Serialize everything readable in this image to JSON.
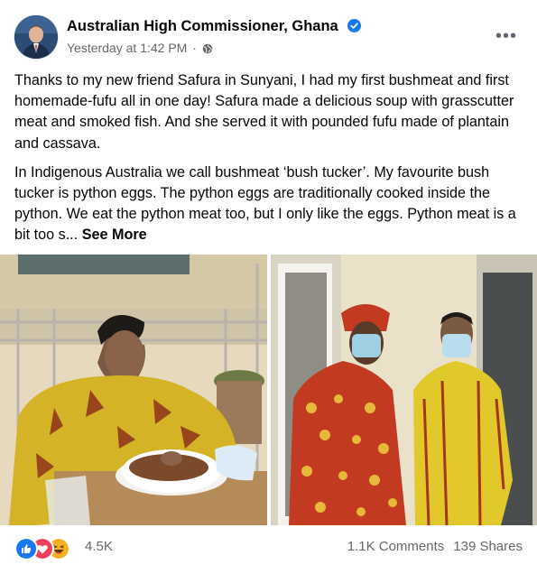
{
  "post": {
    "author": "Australian High Commissioner, Ghana",
    "timestamp": "Yesterday at 1:42 PM",
    "separator": "·",
    "more_icon_label": "•••",
    "paragraph_1": "Thanks to my new friend Safura in Sunyani, I had my first bushmeat and first homemade-fufu all in one day! Safura made a delicious soup with grasscutter meat and smoked fish. And she served it with pounded fufu made of plantain and cassava.",
    "paragraph_2": "In Indigenous Australia we call bushmeat ‘bush tucker’. My favourite bush tucker is python eggs. The python eggs are traditionally cooked inside the python. We eat the python meat too, but I only like the eggs. Python meat is a bit too s...",
    "see_more": "See More"
  },
  "footer": {
    "reaction_count": "4.5K",
    "comments": "1.1K Comments",
    "shares": "139 Shares"
  },
  "icons": {
    "verified": "verified-badge-icon",
    "privacy": "globe-icon",
    "more": "more-options-icon",
    "reactions": [
      "like-icon",
      "love-icon",
      "haha-icon"
    ]
  },
  "colors": {
    "link_blue": "#1877f2",
    "secondary_text": "#65676b",
    "love_red": "#f33e58",
    "haha_yellow": "#f7b125"
  }
}
